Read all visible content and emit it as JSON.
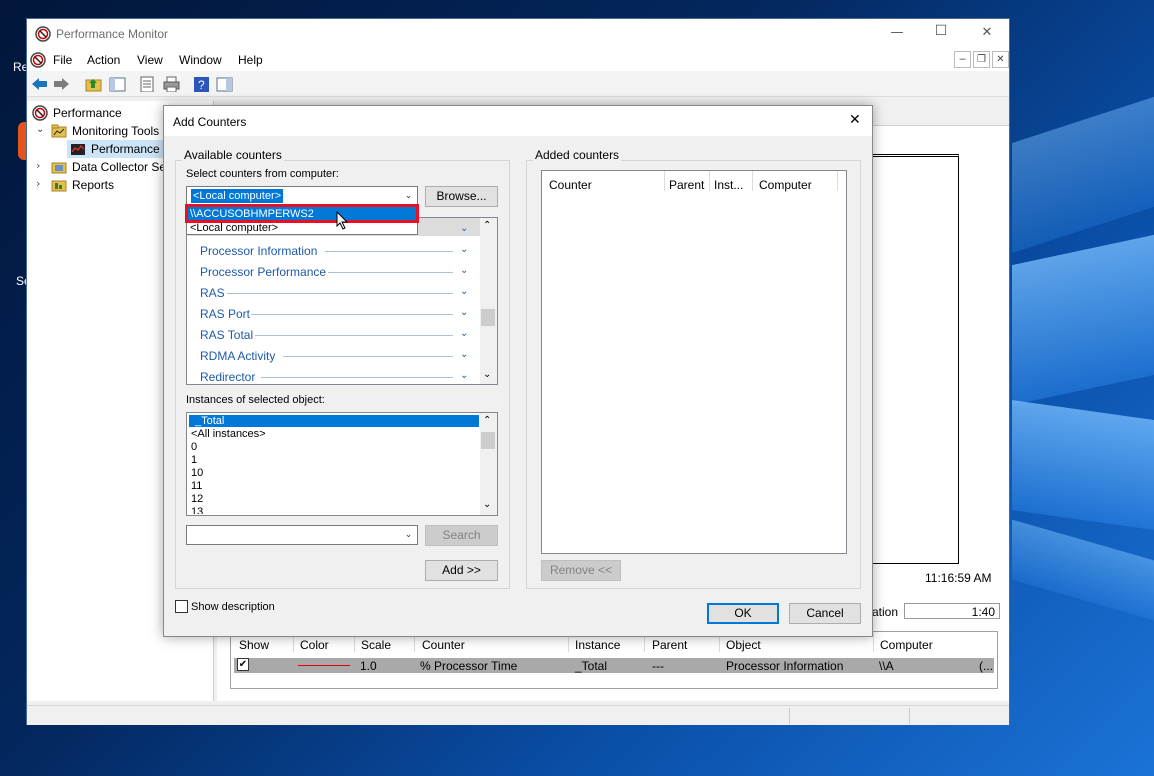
{
  "desktop": {
    "icon1_label": "Re",
    "icon2_label": "Se"
  },
  "window": {
    "title": "Performance Monitor",
    "min_glyph": "—",
    "max_glyph": "☐",
    "close_glyph": "✕",
    "mdi_min": "–",
    "mdi_restore": "❐",
    "mdi_close": "✕"
  },
  "menu": {
    "file": "File",
    "action": "Action",
    "view": "View",
    "window": "Window",
    "help": "Help"
  },
  "tree": {
    "root": "Performance",
    "monitoring_tools": "Monitoring Tools",
    "performance_monitor": "Performance M",
    "data_collector": "Data Collector Set",
    "reports": "Reports"
  },
  "graph": {
    "time": "11:16:59 AM",
    "duration_label": "ation",
    "duration_value": "1:40"
  },
  "counter_table": {
    "headers": {
      "show": "Show",
      "color": "Color",
      "scale": "Scale",
      "counter": "Counter",
      "instance": "Instance",
      "parent": "Parent",
      "object": "Object",
      "computer": "Computer"
    },
    "row": {
      "checked": "✔",
      "scale": "1.0",
      "counter": "% Processor Time",
      "instance": "_Total",
      "parent": "---",
      "object": "Processor Information",
      "computer": "\\\\A",
      "computer_trail": "(..."
    },
    "line_color": "#e00000"
  },
  "dialog": {
    "title": "Add Counters",
    "close_glyph": "✕",
    "available_counters": "Available counters",
    "select_from_computer": "Select counters from computer:",
    "computer_value": "<Local computer>",
    "browse": "Browse...",
    "dropdown_options": [
      "\\\\ACCUSOBHMPERWS2",
      "<Local computer>"
    ],
    "objects": [
      "Processor Information",
      "Processor Performance",
      "RAS",
      "RAS Port",
      "RAS Total",
      "RDMA Activity",
      "Redirector"
    ],
    "instances_label": "Instances of selected object:",
    "instances": [
      "_Total",
      "<All instances>",
      "0",
      "1",
      "10",
      "11",
      "12",
      "13"
    ],
    "search": "Search",
    "add": "Add >>",
    "added_counters": "Added counters",
    "added_headers": {
      "counter": "Counter",
      "parent": "Parent",
      "instance": "Inst...",
      "computer": "Computer"
    },
    "remove": "Remove <<",
    "show_description": "Show description",
    "ok": "OK",
    "cancel": "Cancel"
  },
  "colors": {
    "selection": "#0078d7",
    "highlight_box": "#e81123",
    "link_blue": "#1e5aa8"
  }
}
